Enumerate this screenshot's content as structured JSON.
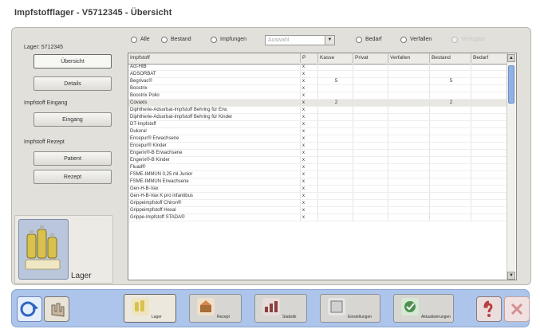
{
  "title": "Impfstofflager - V5712345 - Übersicht",
  "left": {
    "lager_label": "Lager: 5712345",
    "uebersicht_button": "Übersicht",
    "details_button": "Details",
    "eingang_section": "Impfstoff Eingang",
    "eingang_button": "Eingang",
    "rezept_section": "Impfstoff Rezept",
    "button_a": "Patient",
    "button_b": "Rezept",
    "lager_caption": "Lager"
  },
  "filters": {
    "radio_alle": "Alle",
    "radio_bestand": "Bestand",
    "radio_impfungen": "Impfungen",
    "combo_placeholder": "Auswahl",
    "radio_bedarf": "Bedarf",
    "radio_verfallen": "Verfallen",
    "radio_disabled": "Verfügbar"
  },
  "table": {
    "headers": [
      "Impfstoff",
      "P",
      "Kasse",
      "Privat",
      "Verfallen",
      "Bestand",
      "Bedarf"
    ],
    "rows": [
      {
        "name": "Act-HIB",
        "p": "x",
        "kasse": "",
        "privat": "",
        "verfallen": "",
        "bestand": "",
        "bedarf": ""
      },
      {
        "name": "ADSORBAT",
        "p": "x",
        "kasse": "",
        "privat": "",
        "verfallen": "",
        "bestand": "",
        "bedarf": ""
      },
      {
        "name": "Begrivac®",
        "p": "x",
        "kasse": "5",
        "privat": "",
        "verfallen": "",
        "bestand": "5",
        "bedarf": ""
      },
      {
        "name": "Boostrix",
        "p": "x",
        "kasse": "",
        "privat": "",
        "verfallen": "",
        "bestand": "",
        "bedarf": ""
      },
      {
        "name": "Boostrix Polio",
        "p": "x",
        "kasse": "",
        "privat": "",
        "verfallen": "",
        "bestand": "",
        "bedarf": ""
      },
      {
        "name": "Covaxis",
        "p": "x",
        "kasse": "2",
        "privat": "",
        "verfallen": "",
        "bestand": "2",
        "bedarf": ""
      },
      {
        "name": "Diphtherie-Adsorbat-Impfstoff Behring für Erw.",
        "p": "x",
        "kasse": "",
        "privat": "",
        "verfallen": "",
        "bestand": "",
        "bedarf": ""
      },
      {
        "name": "Diphtherie-Adsorbat-Impfstoff Behring für Kinder",
        "p": "x",
        "kasse": "",
        "privat": "",
        "verfallen": "",
        "bestand": "",
        "bedarf": ""
      },
      {
        "name": "DT-Impfstoff",
        "p": "x",
        "kasse": "",
        "privat": "",
        "verfallen": "",
        "bestand": "",
        "bedarf": ""
      },
      {
        "name": "Dukoral",
        "p": "x",
        "kasse": "",
        "privat": "",
        "verfallen": "",
        "bestand": "",
        "bedarf": ""
      },
      {
        "name": "Encepur® Erwachsene",
        "p": "x",
        "kasse": "",
        "privat": "",
        "verfallen": "",
        "bestand": "",
        "bedarf": ""
      },
      {
        "name": "Encepur® Kinder",
        "p": "x",
        "kasse": "",
        "privat": "",
        "verfallen": "",
        "bestand": "",
        "bedarf": ""
      },
      {
        "name": "Engerix®-B Erwachsene",
        "p": "x",
        "kasse": "",
        "privat": "",
        "verfallen": "",
        "bestand": "",
        "bedarf": ""
      },
      {
        "name": "Engerix®-B Kinder",
        "p": "x",
        "kasse": "",
        "privat": "",
        "verfallen": "",
        "bestand": "",
        "bedarf": ""
      },
      {
        "name": "Fluad®",
        "p": "x",
        "kasse": "",
        "privat": "",
        "verfallen": "",
        "bestand": "",
        "bedarf": ""
      },
      {
        "name": "FSME-IMMUN 0,25 ml Junior",
        "p": "x",
        "kasse": "",
        "privat": "",
        "verfallen": "",
        "bestand": "",
        "bedarf": ""
      },
      {
        "name": "FSME-IMMUN Erwachsene",
        "p": "x",
        "kasse": "",
        "privat": "",
        "verfallen": "",
        "bestand": "",
        "bedarf": ""
      },
      {
        "name": "Gen-H-B-Vax",
        "p": "x",
        "kasse": "",
        "privat": "",
        "verfallen": "",
        "bestand": "",
        "bedarf": ""
      },
      {
        "name": "Gen-H-B-Vax K pro infantibus",
        "p": "x",
        "kasse": "",
        "privat": "",
        "verfallen": "",
        "bestand": "",
        "bedarf": ""
      },
      {
        "name": "Grippeimpfstoff Chiron®",
        "p": "x",
        "kasse": "",
        "privat": "",
        "verfallen": "",
        "bestand": "",
        "bedarf": ""
      },
      {
        "name": "Grippeimpfstoff Hexal",
        "p": "x",
        "kasse": "",
        "privat": "",
        "verfallen": "",
        "bestand": "",
        "bedarf": ""
      },
      {
        "name": "Grippe-Impfstoff STADA®",
        "p": "x",
        "kasse": "",
        "privat": "",
        "verfallen": "",
        "bestand": "",
        "bedarf": ""
      }
    ]
  },
  "taskbar": {
    "items": [
      {
        "label": "Lager"
      },
      {
        "label": "Rezept"
      },
      {
        "label": "Statistik"
      },
      {
        "label": "Einstellungen"
      },
      {
        "label": "Aktualisierungen"
      }
    ]
  },
  "colors": {
    "accent_blue": "#8fb1e4",
    "window_bg": "#e2e0da",
    "taskbar_bg": "#adc5eb"
  }
}
